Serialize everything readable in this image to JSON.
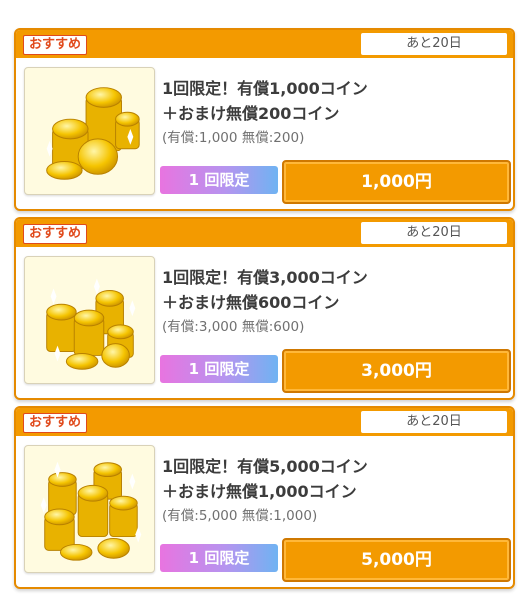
{
  "offers": [
    {
      "badge": "おすすめ",
      "days_left": "あと20日",
      "title_line1": "1回限定！有償1,000コイン",
      "title_line2": "＋おまけ無償200コイン",
      "detail": "(有償:1,000 無償:200)",
      "limit_label": "1 回限定",
      "price": "1,000円",
      "image_icon": "coin-stack-icon"
    },
    {
      "badge": "おすすめ",
      "days_left": "あと20日",
      "title_line1": "1回限定！有償3,000コイン",
      "title_line2": "＋おまけ無償600コイン",
      "detail": "(有償:3,000 無償:600)",
      "limit_label": "1 回限定",
      "price": "3,000円",
      "image_icon": "coin-pile-icon"
    },
    {
      "badge": "おすすめ",
      "days_left": "あと20日",
      "title_line1": "1回限定！有償5,000コイン",
      "title_line2": "＋おまけ無償1,000コイン",
      "detail": "(有償:5,000 無償:1,000)",
      "limit_label": "1 回限定",
      "price": "5,000円",
      "image_icon": "coin-heap-icon"
    }
  ],
  "colors": {
    "accent": "#f39a00",
    "badge_text": "#e04a1c",
    "limit_gradient_start": "#e874e0",
    "limit_gradient_end": "#6fb3f2"
  }
}
